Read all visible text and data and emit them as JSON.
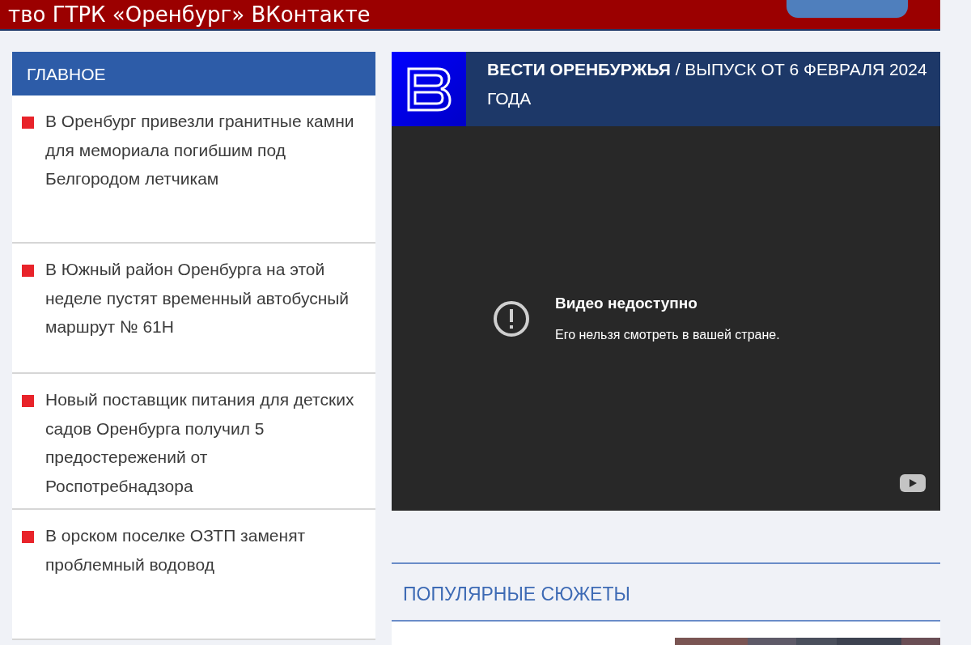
{
  "banner": {
    "text": "тво ГТРК «Оренбург» ВКонтакте"
  },
  "main_news": {
    "title": "ГЛАВНОЕ",
    "items": [
      {
        "text": "В Оренбург привезли гранитные камни для мемориала погибшим под Белгородом летчикам"
      },
      {
        "text": "В Южный район Оренбурга на этой неделе пустят временный автобусный маршрут № 61Н"
      },
      {
        "text": "Новый поставщик питания для детских садов Оренбурга получил 5 предостережений от Роспотребнадзора"
      },
      {
        "text": "В орском поселке ОЗТП заменят проблемный водовод"
      }
    ]
  },
  "video": {
    "title": "**ВЕСТИ ОРЕНБУРЖЬЯ** / ВЫПУСК ОТ 6 ФЕВРАЛЯ 2024 ГОДА",
    "error_title": "Видео недоступно",
    "error_text": "Его нельзя смотреть в вашей стране."
  },
  "popular": {
    "title": "ПОПУЛЯРНЫЕ СЮЖЕТЫ"
  }
}
